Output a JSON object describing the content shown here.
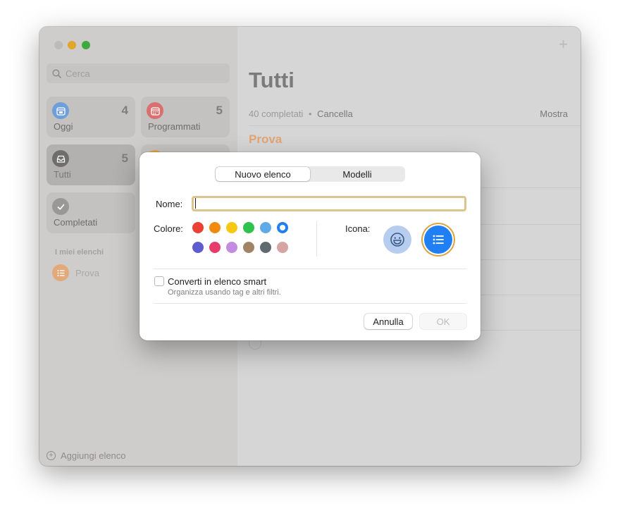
{
  "sidebar": {
    "search_placeholder": "Cerca",
    "cards": [
      {
        "name": "Oggi",
        "count": "4",
        "icon": "calendar-today-icon",
        "color": "#6f9fd8"
      },
      {
        "name": "Programmati",
        "count": "5",
        "icon": "calendar-icon",
        "color": "#d97070"
      },
      {
        "name": "Tutti",
        "count": "5",
        "icon": "tray-icon",
        "color": "#6e6e6e"
      },
      {
        "name": "Completati",
        "count": "",
        "icon": "checkmark-icon",
        "color": "#9a9896"
      }
    ],
    "my_lists_title": "I miei elenchi",
    "lists": [
      {
        "name": "Prova",
        "color": "#e2a97a"
      }
    ],
    "add_list_label": "Aggiungi elenco"
  },
  "main": {
    "title": "Tutti",
    "completed_text": "40 completati",
    "separator": "•",
    "cancel_label": "Cancella",
    "show_label": "Mostra",
    "section_title": "Prova",
    "plus_label": "+"
  },
  "dialog": {
    "tabs": [
      {
        "label": "Nuovo elenco",
        "active": true
      },
      {
        "label": "Modelli",
        "active": false
      }
    ],
    "name_label": "Nome:",
    "name_value": "",
    "color_label": "Colore:",
    "colors_row1": [
      "#eb4034",
      "#f08a0c",
      "#f5c811",
      "#2fc24f",
      "#5eaae8",
      "#1f7ff3"
    ],
    "colors_row2": [
      "#5e5ccf",
      "#e73c6b",
      "#c38be1",
      "#a18466",
      "#5f6a70",
      "#d6a5a2"
    ],
    "selected_color": "#1f7ff3",
    "icon_label": "Icona:",
    "icon_options": [
      "smiley-icon",
      "list-bullet-icon"
    ],
    "smart_checkbox_label": "Converti in elenco smart",
    "smart_checkbox_sub": "Organizza usando tag e altri filtri.",
    "smart_checked": false,
    "cancel_button": "Annulla",
    "ok_button": "OK"
  }
}
